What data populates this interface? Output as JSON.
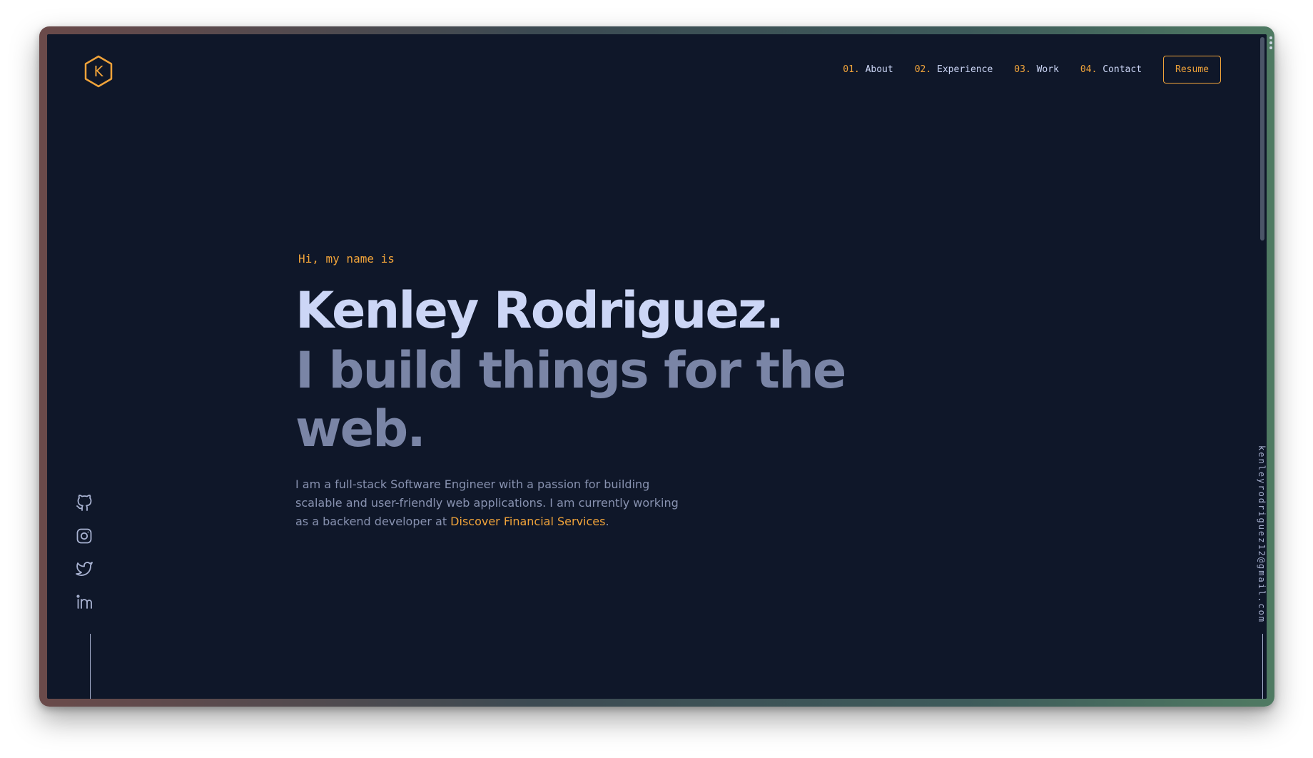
{
  "nav": {
    "logo_letter": "K",
    "items": [
      {
        "num": "01.",
        "label": "About"
      },
      {
        "num": "02.",
        "label": "Experience"
      },
      {
        "num": "03.",
        "label": "Work"
      },
      {
        "num": "04.",
        "label": "Contact"
      }
    ],
    "resume_label": "Resume"
  },
  "hero": {
    "greeting": "Hi, my name is",
    "name": "Kenley Rodriguez.",
    "tagline": "I build things for the web.",
    "bio_text": "I am a full-stack Software Engineer with a passion for building scalable and user-friendly web applications. I am currently working as a backend developer at ",
    "bio_link": "Discover Financial Services",
    "bio_end": "."
  },
  "social": {
    "icons": [
      "github-icon",
      "instagram-icon",
      "twitter-icon",
      "linkedin-icon"
    ]
  },
  "email": "kenleyrodriguez12@gmail.com",
  "colors": {
    "background": "#0f1729",
    "accent": "#f0a33a",
    "heading": "#ccd6f6",
    "subheading": "#7a85a6",
    "body": "#8892b0"
  }
}
